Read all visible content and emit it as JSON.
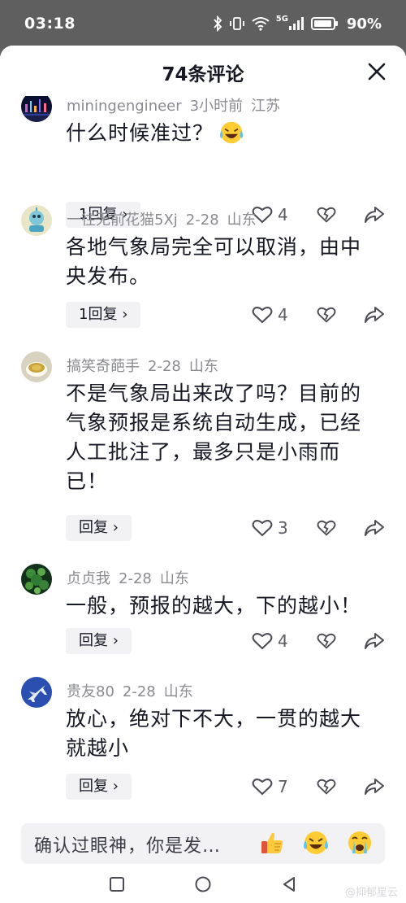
{
  "status_bar": {
    "time": "03:18",
    "network": "5G",
    "battery": "90%"
  },
  "sheet": {
    "title": "74条评论"
  },
  "comments": [
    {
      "user": "miningengineer",
      "time": "3小时前",
      "location": "江苏",
      "text": "什么时候准过？",
      "reply_label": "1回复",
      "likes": "4",
      "avatar_icon": "night-city-avatar",
      "inline_emoji": "laughing-crying-emoji"
    },
    {
      "user": "一往无前花猫5Xj",
      "time": "2-28",
      "location": "山东",
      "text": "各地气象局完全可以取消，由中央发布。",
      "reply_label": "1回复",
      "likes": "4",
      "avatar_icon": "cartoon-avatar"
    },
    {
      "user": "搞笑奇葩手",
      "time": "2-28",
      "location": "山东",
      "text": "不是气象局出来改了吗？目前的气象预报是系统自动生成，已经人工批注了，最多只是小雨而已！",
      "reply_label": "回复",
      "likes": "3",
      "avatar_icon": "tea-cup-avatar"
    },
    {
      "user": "贞贞我",
      "time": "2-28",
      "location": "山东",
      "text": "一般，预报的越大，下的越小！",
      "reply_label": "回复",
      "likes": "4",
      "avatar_icon": "plant-avatar"
    },
    {
      "user": "贵友80",
      "time": "2-28",
      "location": "山东",
      "text": "放心，绝对下不大，一贯的越大就越小",
      "reply_label": "回复",
      "likes": "7",
      "avatar_icon": "jet-avatar"
    }
  ],
  "input": {
    "placeholder": "确认过眼神，你是发…",
    "emojis": [
      "thumbs-up-emoji",
      "laughing-crying-emoji",
      "crying-emoji"
    ]
  },
  "nav": {
    "buttons": [
      "recents-icon",
      "home-icon",
      "back-icon"
    ]
  },
  "watermark": "@抑郁星云",
  "colors": {
    "text_primary": "#161823",
    "text_meta": "#8a8b91",
    "chip_bg": "#f2f2f4",
    "scrim": "#5f5f5f"
  }
}
